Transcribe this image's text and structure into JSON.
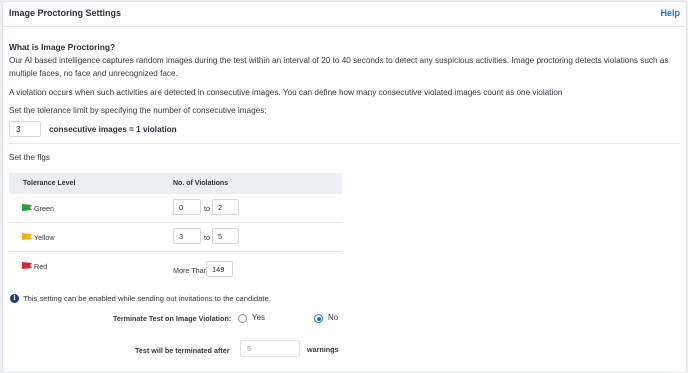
{
  "header": {
    "title": "Image Proctoring Settings",
    "help_label": "Help"
  },
  "intro": {
    "heading": "What is Image Proctoring?",
    "description": "Our AI based intelligence captures random images during the test within an interval of 20 to 40 seconds to detect any suspicious activities. Image proctoring detects violations such as multiple faces, no face and unrecognized face.",
    "violation_text": "A violation occurs when such activities are detected in consecutive images. You can define how many consecutive violated images count as one violation",
    "tolerance_instruction": "Set the tolerance limit by specifying the number of consecutive images:"
  },
  "tolerance": {
    "value": "3",
    "label": "consecutive images = 1 violation"
  },
  "flags": {
    "label": "Set the flgs",
    "columns": [
      "Tolerance Level",
      "No. of Violations"
    ],
    "rows": [
      {
        "level": "Green",
        "flag_color": "#2e9e3a",
        "from": "0",
        "connector": "to",
        "to": "2"
      },
      {
        "level": "Yellow",
        "flag_color": "#f2b400",
        "from": "3",
        "connector": "to",
        "to": "5"
      },
      {
        "level": "Red",
        "flag_color": "#d22a2a",
        "prefix": "More Than",
        "value": "149"
      }
    ]
  },
  "info": {
    "icon": "info-icon",
    "text": "This setting can be enabled while sending out invitations to the candidate."
  },
  "terminate": {
    "label": "Terminate Test on Image Violation:",
    "options": [
      "Yes",
      "No"
    ],
    "selected": "No"
  },
  "warnings": {
    "label": "Test will be terminated after",
    "value": "5",
    "suffix": "warnings"
  },
  "colors": {
    "accent": "#1e6fd9",
    "table_header_bg": "#eceef1"
  }
}
